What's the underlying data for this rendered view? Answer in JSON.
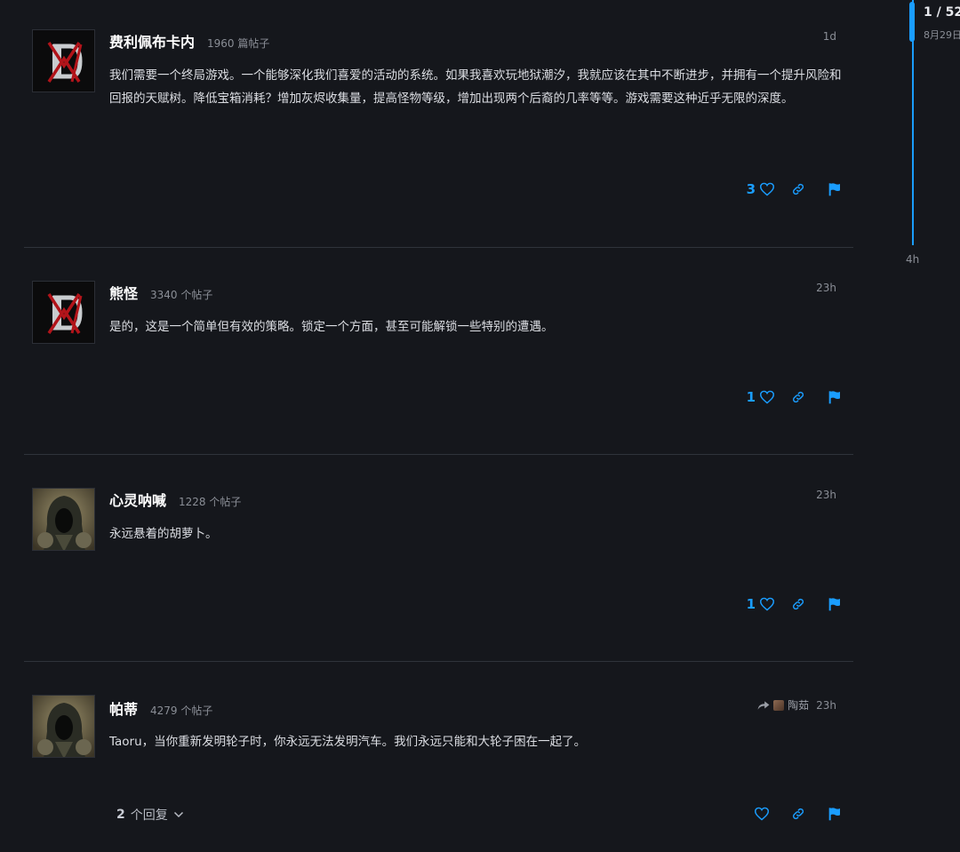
{
  "timeline": {
    "position": "1 / 52",
    "date": "8月29日",
    "end_label": "4h"
  },
  "posts": [
    {
      "avatar": "diablo-iv-logo",
      "username": "费利佩布卡内",
      "post_count": "1960 篇帖子",
      "time": "1d",
      "body": "我们需要一个终局游戏。一个能够深化我们喜爱的活动的系统。如果我喜欢玩地狱潮汐，我就应该在其中不断进步，并拥有一个提升风险和回报的天赋树。降低宝箱消耗？增加灰烬收集量，提高怪物等级，增加出现两个后裔的几率等等。游戏需要这种近乎无限的深度。",
      "likes": "3"
    },
    {
      "avatar": "diablo-iv-logo",
      "username": "熊怪",
      "post_count": "3340 个帖子",
      "time": "23h",
      "body": "是的，这是一个简单但有效的策略。锁定一个方面，甚至可能解锁一些特别的遭遇。",
      "likes": "1"
    },
    {
      "avatar": "hooded-figure",
      "username": "心灵呐喊",
      "post_count": "1228 个帖子",
      "time": "23h",
      "body": "永远悬着的胡萝卜。",
      "likes": "1"
    },
    {
      "avatar": "hooded-figure",
      "username": "帕蒂",
      "post_count": "4279 个帖子",
      "time": "23h",
      "reply_to": "陶茹",
      "body": "Taoru，当你重新发明轮子时，你永远无法发明汽车。我们永远只能和大轮子困在一起了。",
      "likes": "",
      "replies_count": "2",
      "replies_label": "个回复"
    }
  ],
  "colors": {
    "background": "#15171c",
    "accent": "#1a9dff",
    "divider": "#2f333b",
    "muted": "#8a8e96"
  },
  "icons": {
    "like": "heart-icon",
    "share": "link-icon",
    "flag": "flag-icon",
    "reply_to": "share-arrow-icon",
    "expand": "chevron-down-icon"
  }
}
